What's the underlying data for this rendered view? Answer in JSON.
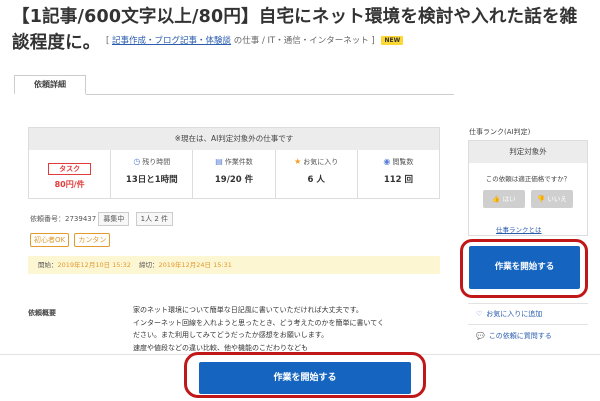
{
  "job": {
    "title": "【1記事/600文字以上/80円】自宅にネット環境を検討や入れた話を雑談程度に。",
    "category_open": "[",
    "category_link": "記事作成・ブログ記事・体験談",
    "category_rest": "の仕事 / IT・通信・インターネット ]",
    "new_badge": "NEW"
  },
  "tabs": [
    {
      "label": "依頼詳細"
    }
  ],
  "ai_notice": "※現在は、AI判定対象外の仕事です",
  "stats": {
    "task": {
      "label": "タスク",
      "value": "80円/件"
    },
    "time_left": {
      "label": "残り時間",
      "value": "13日と1時間"
    },
    "count": {
      "label": "作業件数",
      "value": "19/20 件"
    },
    "favorites": {
      "label": "お気に入り",
      "value": "6 人"
    },
    "views": {
      "label": "閲覧数",
      "value": "112 回"
    }
  },
  "icons": {
    "clock": "clock-icon",
    "doc": "document-icon",
    "star": "star-icon",
    "eye": "eye-icon",
    "thumbs_up": "thumbs-up-icon",
    "thumbs_down": "thumbs-down-icon",
    "heart": "heart-icon",
    "chat": "chat-icon"
  },
  "meta": {
    "request_no": "依頼番号：2739437",
    "status": "募集中",
    "per_person": "1人 2 件"
  },
  "tags": [
    "初心者OK",
    "カンタン"
  ],
  "dates": {
    "start_label": "開始：",
    "start_value": "2019年12月10日 15:32",
    "end_label": "締切：",
    "end_value": "2019年12月24日 15:31"
  },
  "description": {
    "label": "依頼概要",
    "lines": [
      "家のネット環境について簡単な日記風に書いていただければ大丈夫です。",
      "インターネット回線を入れようと思ったとき、どう考えたのかを簡単に書いてく",
      "ださい。また利用してみてどうだったか感想をお願いします。",
      "速度や値段などの違い比較、他や機能のこだわりなども"
    ]
  },
  "sidebar": {
    "rank_title": "仕事ランク(AI判定)",
    "rank_value": "判定対象外",
    "question": "この依頼は適正価格ですか？",
    "yes": "はい",
    "no": "いいえ",
    "rank_link": "仕事ランクとは",
    "start_button": "作業を開始する",
    "favorite_link": "お気に入りに追加",
    "ask_link": "この依頼に質問する"
  },
  "bottom": {
    "start_button": "作業を開始する"
  },
  "colors": {
    "primary_button": "#1565c0",
    "highlight_ring": "#c01818",
    "task_red": "#e23b3b",
    "tag_orange": "#e09a2e",
    "date_bg": "#fdf6d3"
  }
}
